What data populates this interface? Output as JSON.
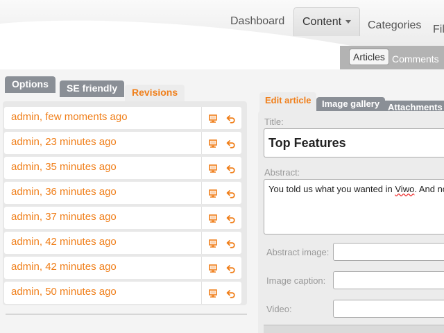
{
  "nav": {
    "main_tabs": [
      {
        "label": "Dashboard",
        "active": false
      },
      {
        "label": "Content",
        "active": true,
        "dropdown": true
      },
      {
        "label": "Categories",
        "active": false
      },
      {
        "label": "Fil",
        "active": false
      }
    ],
    "sub_tabs": [
      {
        "label": "Articles",
        "active": true
      },
      {
        "label": "Comments",
        "active": false
      }
    ]
  },
  "left_tabs": [
    {
      "label": "Options",
      "active": false
    },
    {
      "label": "SE friendly",
      "active": false
    },
    {
      "label": "Revisions",
      "active": true
    }
  ],
  "revisions": [
    {
      "label": "admin, few moments ago"
    },
    {
      "label": "admin, 23 minutes ago"
    },
    {
      "label": "admin, 35 minutes ago"
    },
    {
      "label": "admin, 36 minutes ago"
    },
    {
      "label": "admin, 37 minutes ago"
    },
    {
      "label": "admin, 42 minutes ago"
    },
    {
      "label": "admin, 42 minutes ago"
    },
    {
      "label": "admin, 50 minutes ago"
    }
  ],
  "right_tabs": [
    {
      "label": "Edit article",
      "active": true
    },
    {
      "label": "Image gallery",
      "active": false
    },
    {
      "label": "Attachments",
      "active": false
    }
  ],
  "form": {
    "title_label": "Title:",
    "title_value": "Top Features",
    "abstract_label": "Abstract:",
    "abstract_before": "You told us what you wanted in ",
    "abstract_typo": "Viwo",
    "abstract_after": ". And now",
    "abstract_image_label": "Abstract image:",
    "image_caption_label": "Image caption:",
    "video_label": "Video:"
  },
  "colors": {
    "accent": "#f07f1a",
    "tab_inactive": "#8a8f96",
    "panel": "#e8e8e8"
  },
  "icons": {
    "preview": "monitor-icon",
    "revert": "undo-arrow-icon"
  }
}
